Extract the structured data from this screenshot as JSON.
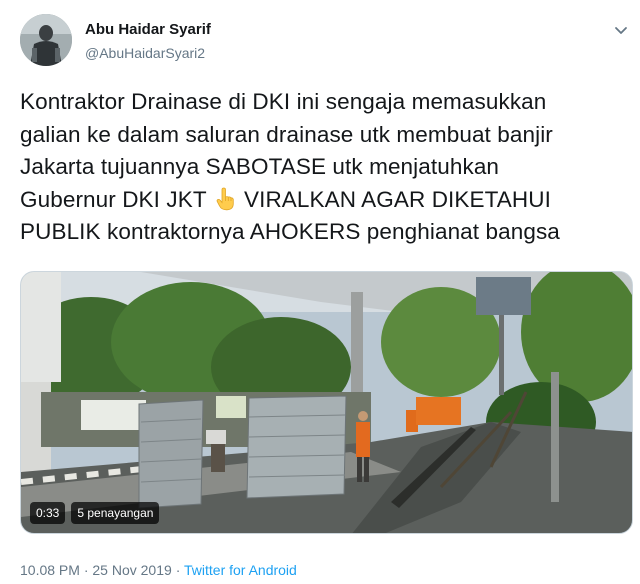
{
  "author": {
    "name": "Abu Haidar Syarif",
    "handle": "@AbuHaidarSyari2"
  },
  "tweet": {
    "lines": [
      "Kontraktor Drainase di DKI ini sengaja memasukkan",
      "galian ke dalam saluran drainase utk membuat banjir",
      "Jakarta tujuannya SABOTASE utk menjatuhkan",
      "Gubernur DKI JKT",
      "VIRALKAN AGAR DIKETAHUI",
      "PUBLIK kontraktornya AHOKERS penghianat bangsa"
    ],
    "emoji_icon": "pointing-up-hand"
  },
  "video": {
    "duration": "0:33",
    "views": "5 penayangan"
  },
  "footer": {
    "time": "10.08 PM",
    "date": "25 Nov 2019",
    "separator": "·",
    "source": "Twitter for Android"
  },
  "colors": {
    "text": "#14171a",
    "secondary": "#657786",
    "link": "#1da1f2"
  },
  "icons": {
    "more_menu": "chevron-down-icon"
  }
}
